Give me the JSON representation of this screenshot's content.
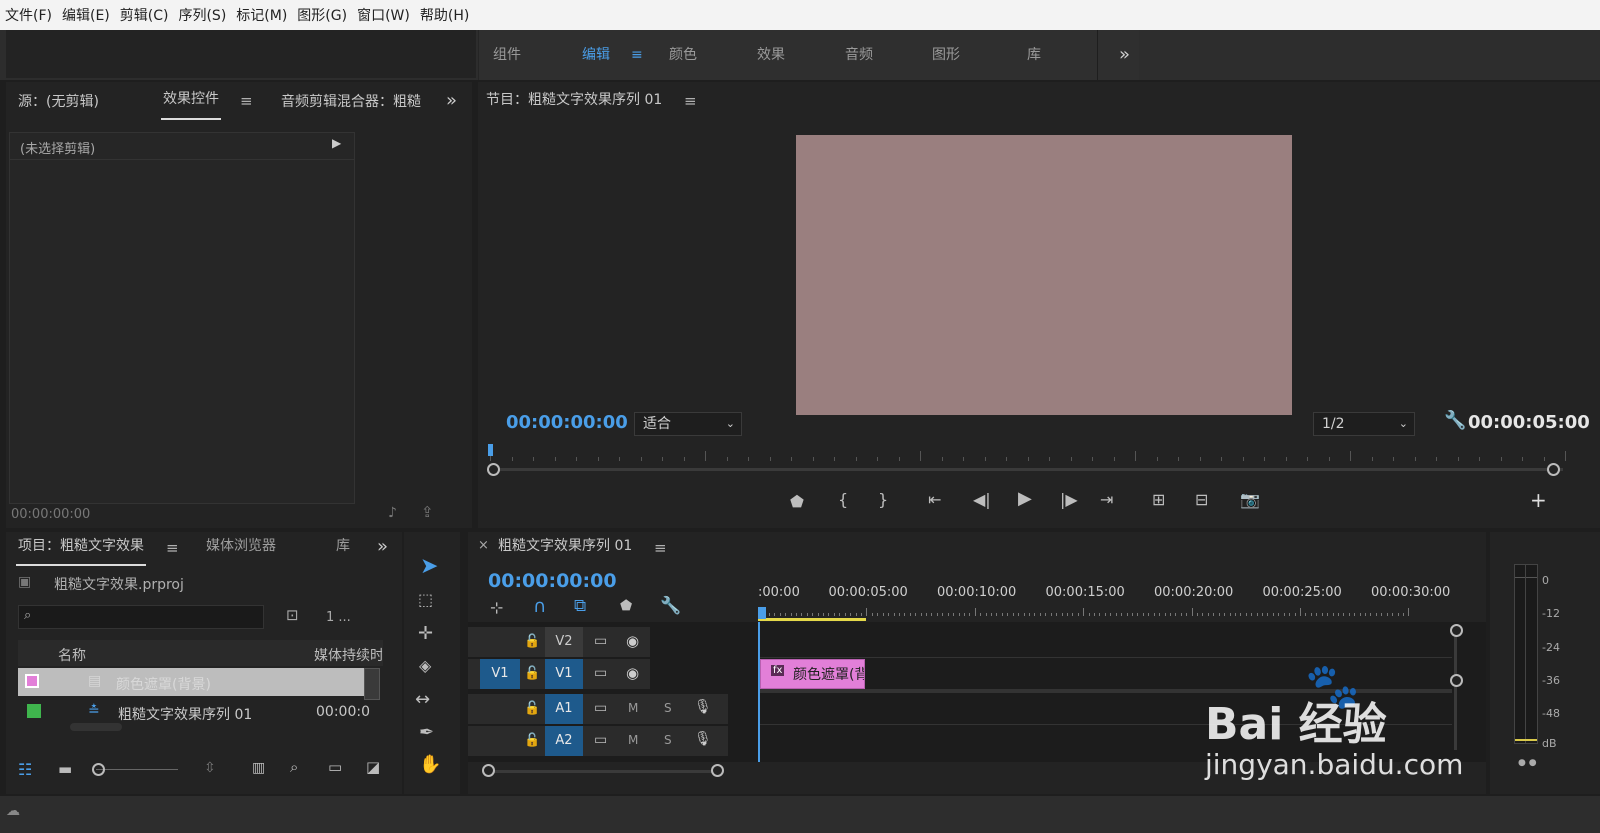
{
  "menu": [
    "文件(F)",
    "编辑(E)",
    "剪辑(C)",
    "序列(S)",
    "标记(M)",
    "图形(G)",
    "窗口(W)",
    "帮助(H)"
  ],
  "workspaces": {
    "tabs": [
      "组件",
      "编辑",
      "颜色",
      "效果",
      "音频",
      "图形",
      "库"
    ],
    "active": "编辑",
    "more": "»"
  },
  "source_panel": {
    "tabs": [
      "源：(无剪辑)",
      "效果控件",
      "音频剪辑混合器：粗糙"
    ],
    "active_tab": "效果控件",
    "no_clip": "(未选择剪辑)",
    "timecode": "00:00:00:00"
  },
  "program_monitor": {
    "title": "节目：粗糙文字效果序列 01",
    "timecode_current": "00:00:00:00",
    "fit": "适合",
    "resolution": "1/2",
    "timecode_duration": "00:00:05:00",
    "preview_color": "#9a7f7f"
  },
  "project_panel": {
    "tabs": [
      "项目：粗糙文字效果",
      "媒体浏览器",
      "库"
    ],
    "project_file": "粗糙文字效果.prproj",
    "item_count": "1 ...",
    "columns": [
      "名称",
      "媒体持续时"
    ],
    "items": [
      {
        "name": "颜色遮罩(背景)",
        "duration": "",
        "color": "#e27fd8"
      },
      {
        "name": "粗糙文字效果序列 01",
        "duration": "00:00:0",
        "color": "#3fb54d"
      }
    ]
  },
  "timeline": {
    "title": "粗糙文字效果序列 01",
    "close": "×",
    "timecode": "00:00:00:00",
    "ruler": [
      ":00:00",
      "00:00:05:00",
      "00:00:10:00",
      "00:00:15:00",
      "00:00:20:00",
      "00:00:25:00",
      "00:00:30:00"
    ],
    "tracks": [
      {
        "name": "V2",
        "target": "",
        "btn1": "",
        "btn2": ""
      },
      {
        "name": "V1",
        "target": "V1",
        "btn1": "",
        "btn2": ""
      },
      {
        "name": "A1",
        "target": "",
        "btn1": "M",
        "btn2": "S"
      },
      {
        "name": "A2",
        "target": "",
        "btn1": "M",
        "btn2": "S"
      }
    ],
    "clip_label": "颜色遮罩(背",
    "clip_fx": "fx"
  },
  "meter": {
    "scale": [
      "0",
      "-12",
      "-24",
      "-36",
      "-48",
      "dB"
    ]
  },
  "watermark": {
    "brand": "Bai 经验",
    "url": "jingyan.baidu.com"
  }
}
